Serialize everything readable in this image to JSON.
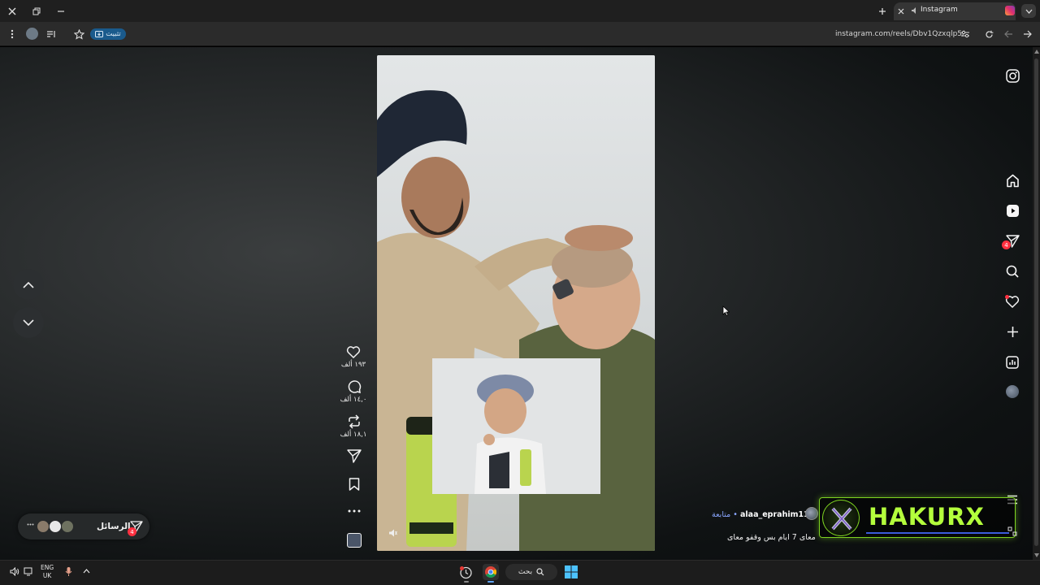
{
  "browser": {
    "tab_title": "Instagram",
    "url": "instagram.com/reels/Dbv1Qzxqlp5/",
    "install_pill": "تثبيت",
    "colors": {
      "tab_bg": "#353535",
      "pwa_pill": "#1a5a8c"
    }
  },
  "reel_actions": {
    "likes": "١٩٣ ألف",
    "comments": "١٤,٠ ألف",
    "reposts": "١٨,١ ألف"
  },
  "author": {
    "username": "alaa_eprahim11",
    "follow_label": "متابعة •",
    "caption": "معاى 7 ايام بس وقفو معاى"
  },
  "sidebar": {
    "icons": [
      "instagram-logo-icon",
      "home-icon",
      "reels-icon",
      "messages-icon",
      "search-icon",
      "notifications-icon",
      "create-icon",
      "dashboard-icon",
      "profile-avatar"
    ],
    "messages_badge": "4"
  },
  "messages_bar": {
    "label": "الرسائل",
    "badge": "4"
  },
  "watermark": {
    "text": "HAKURX",
    "color": "#b4ff3c"
  },
  "taskbar": {
    "search_label": "بحث",
    "lang_top": "ENG",
    "lang_bottom": "UK"
  }
}
